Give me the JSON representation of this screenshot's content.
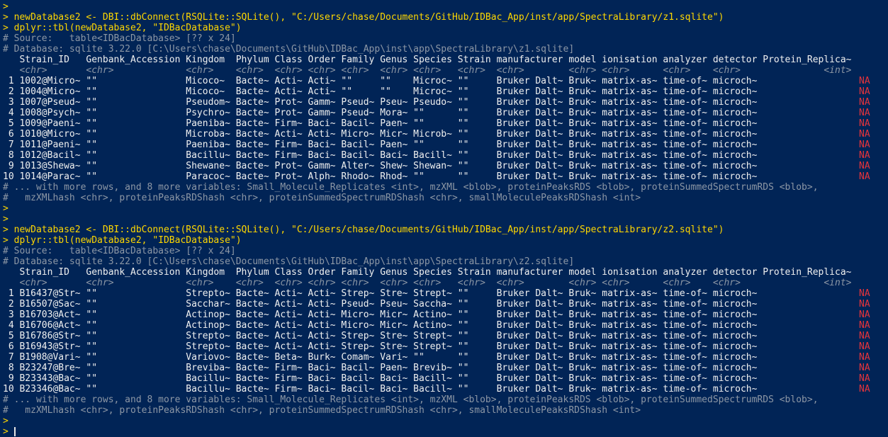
{
  "colors": {
    "background": "#012456",
    "prompt": "#ffd700",
    "comment": "#8d97a5",
    "text": "#f0f0f0",
    "na": "#e8343b"
  },
  "console_lines": [
    {
      "kind": "prompt",
      "text": ">"
    },
    {
      "kind": "code",
      "text": "> newDatabase2 <- DBI::dbConnect(RSQLite::SQLite(), \"C:/Users/chase/Documents/GitHub/IDBac_App/inst/app/SpectraLibrary/z1.sqlite\")"
    },
    {
      "kind": "code",
      "text": "> dplyr::tbl(newDatabase2, \"IDBacDatabase\")"
    },
    {
      "kind": "comment",
      "text": "# Source:   table<IDBacDatabase> [?? x 24]"
    },
    {
      "kind": "comment",
      "text": "# Database: sqlite 3.22.0 [C:\\Users\\chase\\Documents\\GitHub\\IDBac_App\\inst\\app\\SpectraLibrary\\z1.sqlite]"
    },
    {
      "kind": "header",
      "text": "   Strain_ID   Genbank_Accession Kingdom  Phylum Class Order Family Genus Species Strain manufacturer model ionisation analyzer detector Protein_Replica~"
    },
    {
      "kind": "types",
      "text": "   <chr>       <chr>             <chr>    <chr>  <chr> <chr> <chr>  <chr> <chr>   <chr>  <chr>        <chr> <chr>      <chr>    <chr>               <int>"
    },
    {
      "kind": "row",
      "text": " 1 1002@Micro~ \"\"                Micoco~  Bacte~ Acti~ Acti~ \"\"     \"\"    Microc~ \"\"     Bruker Dalt~ Bruk~ matrix-as~ time-of~ microch~",
      "na": "NA"
    },
    {
      "kind": "row",
      "text": " 2 1004@Micro~ \"\"                Micoco~  Bacte~ Acti~ Acti~ \"\"     \"\"    Microc~ \"\"     Bruker Dalt~ Bruk~ matrix-as~ time-of~ microch~",
      "na": "NA"
    },
    {
      "kind": "row",
      "text": " 3 1007@Pseud~ \"\"                Pseudom~ Bacte~ Prot~ Gamm~ Pseud~ Pseu~ Pseudo~ \"\"     Bruker Dalt~ Bruk~ matrix-as~ time-of~ microch~",
      "na": "NA"
    },
    {
      "kind": "row",
      "text": " 4 1008@Psych~ \"\"                Psychro~ Bacte~ Prot~ Gamm~ Pseud~ Mora~ \"\"      \"\"     Bruker Dalt~ Bruk~ matrix-as~ time-of~ microch~",
      "na": "NA"
    },
    {
      "kind": "row",
      "text": " 5 1009@Paeni~ \"\"                Paeniba~ Bacte~ Firm~ Baci~ Bacil~ Paen~ \"\"      \"\"     Bruker Dalt~ Bruk~ matrix-as~ time-of~ microch~",
      "na": "NA"
    },
    {
      "kind": "row",
      "text": " 6 1010@Micro~ \"\"                Microba~ Bacte~ Acti~ Acti~ Micro~ Micr~ Microb~ \"\"     Bruker Dalt~ Bruk~ matrix-as~ time-of~ microch~",
      "na": "NA"
    },
    {
      "kind": "row",
      "text": " 7 1011@Paeni~ \"\"                Paeniba~ Bacte~ Firm~ Baci~ Bacil~ Paen~ \"\"      \"\"     Bruker Dalt~ Bruk~ matrix-as~ time-of~ microch~",
      "na": "NA"
    },
    {
      "kind": "row",
      "text": " 8 1012@Bacil~ \"\"                Bacillu~ Bacte~ Firm~ Baci~ Bacil~ Baci~ Bacill~ \"\"     Bruker Dalt~ Bruk~ matrix-as~ time-of~ microch~",
      "na": "NA"
    },
    {
      "kind": "row",
      "text": " 9 1013@Shewa~ \"\"                Shewane~ Bacte~ Prot~ Gamm~ Alter~ Shew~ Shewan~ \"\"     Bruker Dalt~ Bruk~ matrix-as~ time-of~ microch~",
      "na": "NA"
    },
    {
      "kind": "row",
      "text": "10 1014@Parac~ \"\"                Paracoc~ Bacte~ Prot~ Alph~ Rhodo~ Rhod~ \"\"      \"\"     Bruker Dalt~ Bruk~ matrix-as~ time-of~ microch~",
      "na": "NA"
    },
    {
      "kind": "comment",
      "text": "# ... with more rows, and 8 more variables: Small_Molecule_Replicates <int>, mzXML <blob>, proteinPeaksRDS <blob>, proteinSummedSpectrumRDS <blob>,"
    },
    {
      "kind": "comment",
      "text": "#   mzXMLhash <chr>, proteinPeaksRDShash <chr>, proteinSummedSpectrumRDShash <chr>, smallMoleculePeaksRDShash <int>"
    },
    {
      "kind": "prompt",
      "text": ">"
    },
    {
      "kind": "prompt",
      "text": ">"
    },
    {
      "kind": "code",
      "text": "> newDatabase2 <- DBI::dbConnect(RSQLite::SQLite(), \"C:/Users/chase/Documents/GitHub/IDBac_App/inst/app/SpectraLibrary/z2.sqlite\")"
    },
    {
      "kind": "code",
      "text": "> dplyr::tbl(newDatabase2, \"IDBacDatabase\")"
    },
    {
      "kind": "comment",
      "text": "# Source:   table<IDBacDatabase> [?? x 24]"
    },
    {
      "kind": "comment",
      "text": "# Database: sqlite 3.22.0 [C:\\Users\\chase\\Documents\\GitHub\\IDBac_App\\inst\\app\\SpectraLibrary\\z2.sqlite]"
    },
    {
      "kind": "header",
      "text": "   Strain_ID   Genbank_Accession Kingdom  Phylum Class Order Family Genus Species Strain manufacturer model ionisation analyzer detector Protein_Replica~"
    },
    {
      "kind": "types",
      "text": "   <chr>       <chr>             <chr>    <chr>  <chr> <chr> <chr>  <chr> <chr>   <chr>  <chr>        <chr> <chr>      <chr>    <chr>               <int>"
    },
    {
      "kind": "row",
      "text": " 1 B16437@Str~ \"\"                Strepto~ Bacte~ Acti~ Acti~ Strep~ Stre~ Strept~ \"\"     Bruker Dalt~ Bruk~ matrix-as~ time-of~ microch~",
      "na": "NA"
    },
    {
      "kind": "row",
      "text": " 2 B16507@Sac~ \"\"                Sacchar~ Bacte~ Acti~ Acti~ Pseud~ Pseu~ Saccha~ \"\"     Bruker Dalt~ Bruk~ matrix-as~ time-of~ microch~",
      "na": "NA"
    },
    {
      "kind": "row",
      "text": " 3 B16703@Act~ \"\"                Actinop~ Bacte~ Acti~ Acti~ Micro~ Micr~ Actino~ \"\"     Bruker Dalt~ Bruk~ matrix-as~ time-of~ microch~",
      "na": "NA"
    },
    {
      "kind": "row",
      "text": " 4 B16706@Act~ \"\"                Actinop~ Bacte~ Acti~ Acti~ Micro~ Micr~ Actino~ \"\"     Bruker Dalt~ Bruk~ matrix-as~ time-of~ microch~",
      "na": "NA"
    },
    {
      "kind": "row",
      "text": " 5 B16786@Str~ \"\"                Strepto~ Bacte~ Acti~ Acti~ Strep~ Stre~ Strept~ \"\"     Bruker Dalt~ Bruk~ matrix-as~ time-of~ microch~",
      "na": "NA"
    },
    {
      "kind": "row",
      "text": " 6 B16943@Str~ \"\"                Strepto~ Bacte~ Acti~ Acti~ Strep~ Stre~ Strept~ \"\"     Bruker Dalt~ Bruk~ matrix-as~ time-of~ microch~",
      "na": "NA"
    },
    {
      "kind": "row",
      "text": " 7 B1908@Vari~ \"\"                Variovo~ Bacte~ Beta~ Burk~ Comam~ Vari~ \"\"      \"\"     Bruker Dalt~ Bruk~ matrix-as~ time-of~ microch~",
      "na": "NA"
    },
    {
      "kind": "row",
      "text": " 8 B23247@Bre~ \"\"                Breviba~ Bacte~ Firm~ Baci~ Bacil~ Paen~ Brevib~ \"\"     Bruker Dalt~ Bruk~ matrix-as~ time-of~ microch~",
      "na": "NA"
    },
    {
      "kind": "row",
      "text": " 9 B23343@Bac~ \"\"                Bacillu~ Bacte~ Firm~ Baci~ Bacil~ Baci~ Bacill~ \"\"     Bruker Dalt~ Bruk~ matrix-as~ time-of~ microch~",
      "na": "NA"
    },
    {
      "kind": "row",
      "text": "10 B23346@Bac~ \"\"                Bacillu~ Bacte~ Firm~ Baci~ Bacil~ Baci~ Bacill~ \"\"     Bruker Dalt~ Bruk~ matrix-as~ time-of~ microch~",
      "na": "NA"
    },
    {
      "kind": "comment",
      "text": "# ... with more rows, and 8 more variables: Small_Molecule_Replicates <int>, mzXML <blob>, proteinPeaksRDS <blob>, proteinSummedSpectrumRDS <blob>,"
    },
    {
      "kind": "comment",
      "text": "#   mzXMLhash <chr>, proteinPeaksRDShash <chr>, proteinSummedSpectrumRDShash <chr>, smallMoleculePeaksRDShash <int>"
    },
    {
      "kind": "prompt",
      "text": ">"
    },
    {
      "kind": "input",
      "text": ">"
    }
  ]
}
